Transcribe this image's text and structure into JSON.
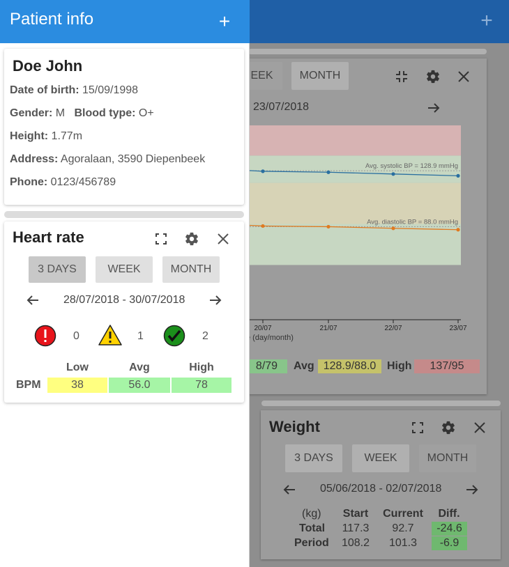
{
  "app": {
    "add_icon": "plus-icon"
  },
  "drawer": {
    "title": "Patient info",
    "add_icon": "plus-icon"
  },
  "patient": {
    "name": "Doe John",
    "dob_label": "Date of birth:",
    "dob": "15/09/1998",
    "gender_label": "Gender:",
    "gender": "M",
    "blood_label": "Blood type:",
    "blood": "O+",
    "height_label": "Height:",
    "height": "1.77m",
    "address_label": "Address:",
    "address": "Agoralaan, 3590 Diepenbeek",
    "phone_label": "Phone:",
    "phone": "0123/456789"
  },
  "heart_rate": {
    "title": "Heart rate",
    "tabs": [
      "3 DAYS",
      "WEEK",
      "MONTH"
    ],
    "active_tab": "3 DAYS",
    "range": "28/07/2018 - 30/07/2018",
    "counts": {
      "alert": "0",
      "warning": "1",
      "ok": "2"
    },
    "headers": [
      "Low",
      "Avg",
      "High"
    ],
    "row_label": "BPM",
    "values": [
      "38",
      "56.0",
      "78"
    ],
    "colors": {
      "low": "#ffff80",
      "avg": "#a6f5a6",
      "high": "#a6f5a6"
    }
  },
  "blood_pressure": {
    "tabs": [
      "EEK",
      "MONTH"
    ],
    "range": "23/07/2018",
    "annotations": [
      "Avg. systolic BP = 128.9 mmHg",
      "Avg. diastolic BP = 88.0 mmHg"
    ],
    "xlabel": "e (day/month)",
    "summary": {
      "low_value": "8/79",
      "avg_label": "Avg",
      "avg_value": "128.9/88.0",
      "high_label": "High",
      "high_value": "137/95"
    }
  },
  "weight": {
    "title": "Weight",
    "tabs": [
      "3 DAYS",
      "WEEK",
      "MONTH"
    ],
    "active_tab": "MONTH",
    "range": "05/06/2018 - 02/07/2018",
    "unit": "(kg)",
    "headers": [
      "Start",
      "Current",
      "Diff."
    ],
    "rows": [
      {
        "label": "Total",
        "start": "117.3",
        "current": "92.7",
        "diff": "-24.6"
      },
      {
        "label": "Period",
        "start": "108.2",
        "current": "101.3",
        "diff": "-6.9"
      }
    ]
  },
  "chart_data": {
    "type": "line",
    "x": [
      "20/07",
      "21/07",
      "22/07",
      "23/07"
    ],
    "xlabel": "e (day/month)",
    "series": [
      {
        "name": "systolic",
        "values": [
          128.5,
          127.8,
          126.5,
          125.2
        ]
      },
      {
        "name": "diastolic",
        "values": [
          88.5,
          88.0,
          86.8,
          85.8
        ]
      }
    ],
    "annotations": [
      "Avg. systolic BP = 128.9 mmHg",
      "Avg. diastolic BP = 88.0 mmHg"
    ],
    "bands": [
      {
        "from": 60,
        "to": 90,
        "color": "#c7d7c2"
      },
      {
        "from": 90,
        "to": 120,
        "color": "#d7d3b6"
      },
      {
        "from": 120,
        "to": 140,
        "color": "#c7d7c2"
      },
      {
        "from": 140,
        "to": 180,
        "color": "#d7b3b3"
      }
    ],
    "ylim": [
      20,
      160
    ],
    "colors": {
      "systolic": "#2a6fa0",
      "diastolic": "#e07a20"
    }
  }
}
